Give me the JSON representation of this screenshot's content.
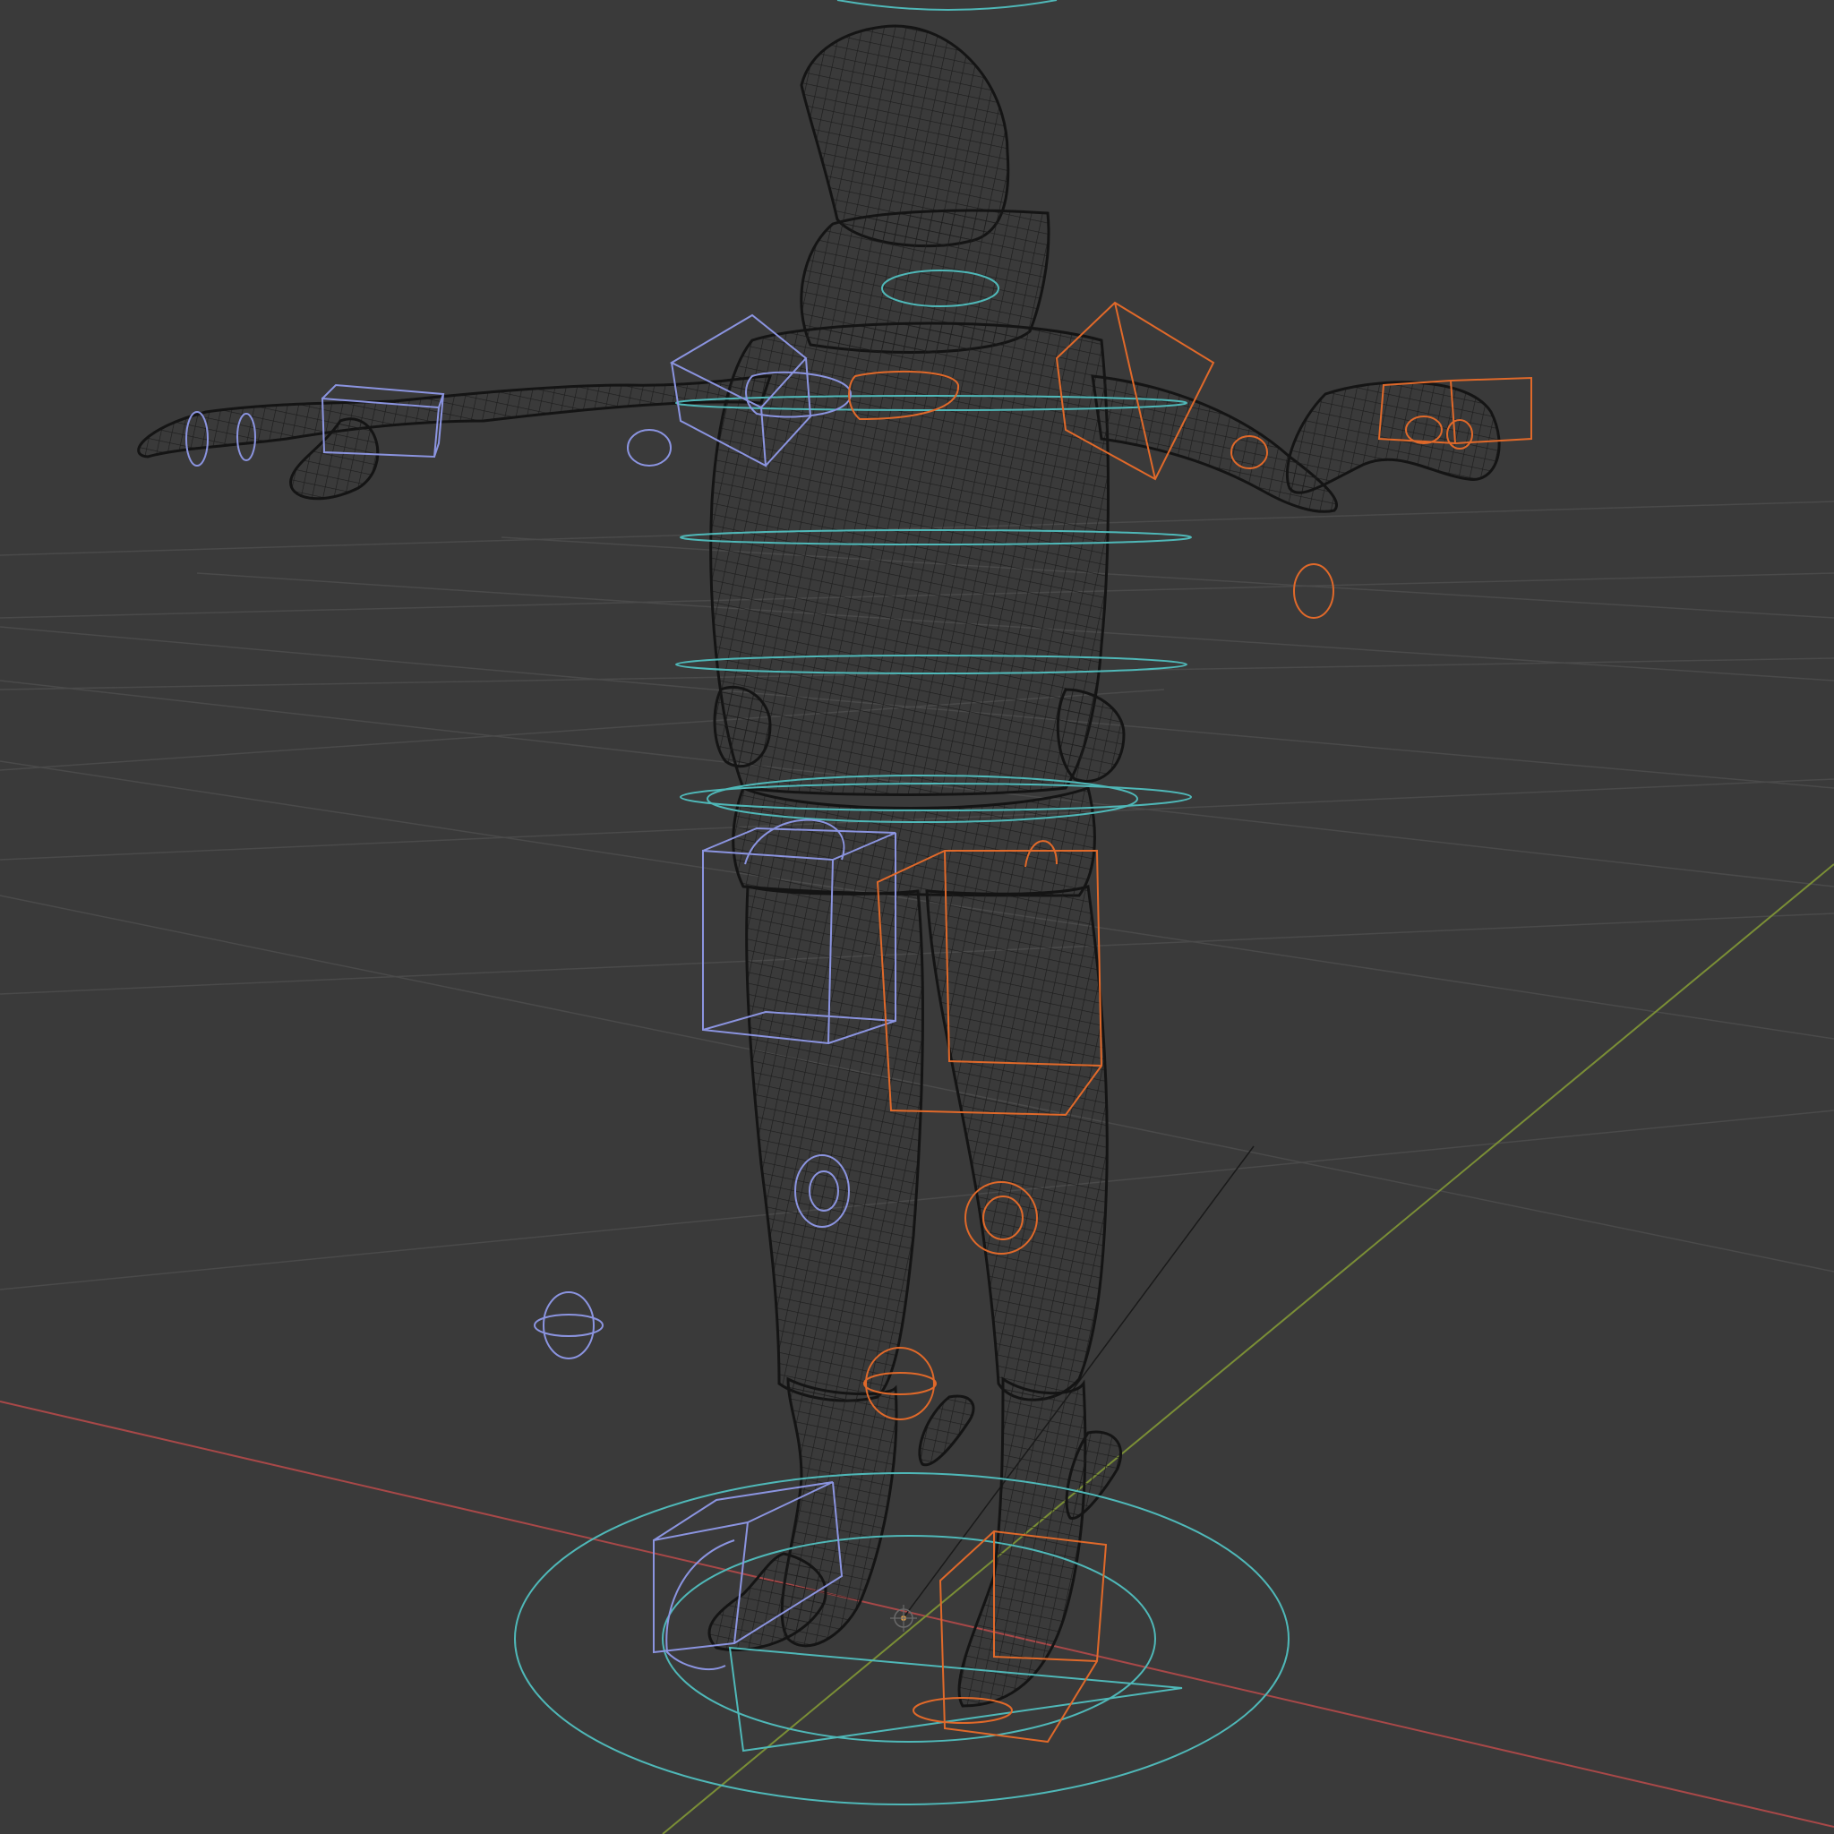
{
  "viewport": {
    "background": "#3a3a3a",
    "view_mode": "wireframe"
  },
  "colors": {
    "grid": "#4a4a4a",
    "x_axis": "#a84848",
    "y_axis": "#7a8e36",
    "mesh": "#141414",
    "rig_left": "#8b94e0",
    "rig_right": "#e0692a",
    "rig_center": "#4fb8b8",
    "origin": "#e8a040"
  },
  "scene": {
    "object": "character-mesh",
    "rig_controls": [
      "neck-ring",
      "chest-ring",
      "spine-ring",
      "waist-ring",
      "hip-ring",
      "root-circle",
      "shoulder-cube-left",
      "shoulder-cube-right",
      "hand-cube-left",
      "hand-cube-right",
      "thigh-cube-left",
      "thigh-cube-right",
      "foot-cube-left",
      "foot-cube-right",
      "knee-pole-left",
      "knee-pole-right"
    ]
  }
}
